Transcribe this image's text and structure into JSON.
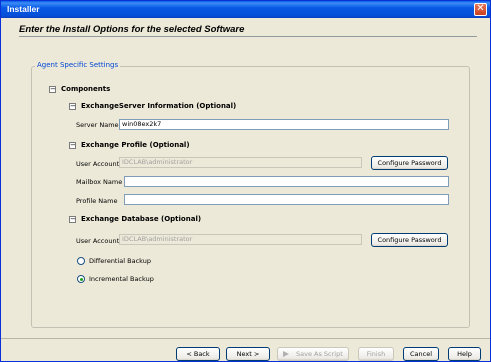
{
  "window": {
    "title": "Installer",
    "close_glyph": "✕"
  },
  "heading": "Enter the Install Options for the selected Software",
  "group": {
    "legend": "Agent Specific Settings",
    "components_label": "Components",
    "exchange_server": {
      "header": "ExchangeServer Information (Optional)",
      "server_name_label": "Server Name",
      "server_name_value": "win08ex2k7"
    },
    "exchange_profile": {
      "header": "Exchange Profile (Optional)",
      "user_account_label": "User Account",
      "user_account_value": "IDCLAB\\administrator",
      "configure_password": "Configure Password",
      "mailbox_name_label": "Mailbox Name",
      "mailbox_name_value": "",
      "profile_name_label": "Profile Name",
      "profile_name_value": ""
    },
    "exchange_database": {
      "header": "Exchange Database (Optional)",
      "user_account_label": "User Account",
      "user_account_value": "IDCLAB\\administrator",
      "configure_password": "Configure Password",
      "differential_label": "Differential Backup",
      "incremental_label": "Incremental Backup",
      "selected": "incremental"
    }
  },
  "footer": {
    "back": "< Back",
    "next": "Next >",
    "save_script": "Save As Script",
    "finish": "Finish",
    "cancel": "Cancel",
    "help": "Help"
  },
  "icons": {
    "tree_collapse": "minus-box-icon",
    "save_script": "script-play-icon"
  }
}
